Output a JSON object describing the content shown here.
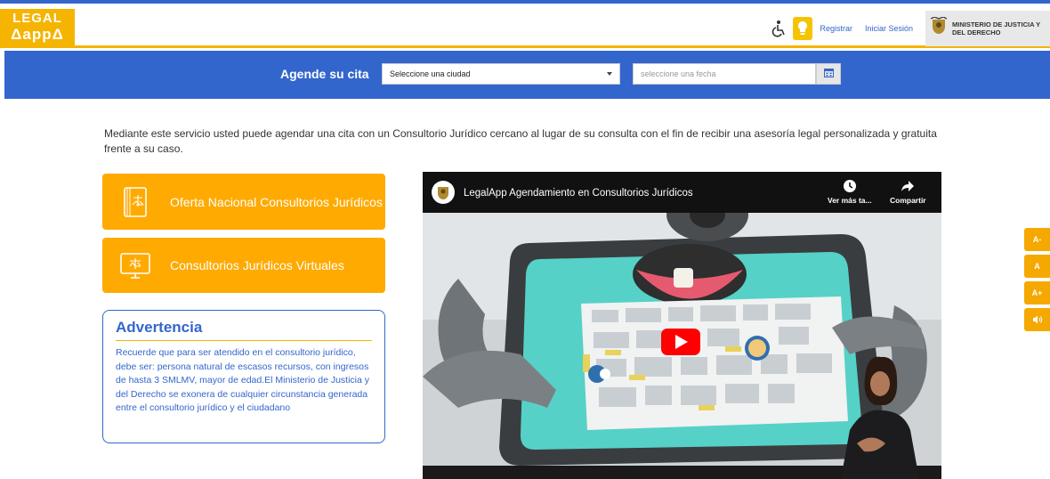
{
  "header": {
    "logo": {
      "line1": "LEGAL",
      "line2": "ΔappΔ"
    },
    "register_label": "Registrar",
    "login_label": "Iniciar Sesión",
    "ministry_line1": "MINISTERIO DE JUSTICIA Y",
    "ministry_line2": "DEL DERECHO",
    "icons": [
      "accessibility-icon",
      "lightbulb-icon",
      "coat-of-arms-icon"
    ]
  },
  "booking": {
    "label": "Agende su cita",
    "city_value": "Seleccione una ciudad",
    "date_placeholder": "seleccione una fecha",
    "icons": [
      "chevron-down-icon",
      "calendar-icon"
    ]
  },
  "intro_text": "Mediante este servicio usted puede agendar una cita con un Consultorio Jurídico cercano al lugar de su consulta con el fin de recibir una asesoría legal personalizada y gratuita frente a su caso.",
  "actions": {
    "national_offer_label": "Oferta Nacional Consultorios Jurídicos",
    "virtual_label": "Consultorios Jurídicos Virtuales"
  },
  "warning": {
    "title": "Advertencia",
    "body": "Recuerde que para ser atendido en el consultorio jurídico, debe ser: persona natural de escasos recursos, con ingresos de hasta 3 SMLMV, mayor de edad.El Ministerio de Justicia y del Derecho se exonera de cualquier circunstancia generada entre el consultorio jurídico y el ciudadano"
  },
  "video": {
    "title": "LegalApp Agendamiento en Consultorios Jurídicos",
    "watch_later_label": "Ver más ta...",
    "share_label": "Compartir"
  },
  "font_tools": {
    "decrease": "A-",
    "normal": "A",
    "increase": "A+",
    "audio_icon": "speaker-icon"
  },
  "colors": {
    "brand_blue": "#3366cc",
    "brand_orange": "#ffaa00",
    "youtube_red": "#ff0000"
  }
}
